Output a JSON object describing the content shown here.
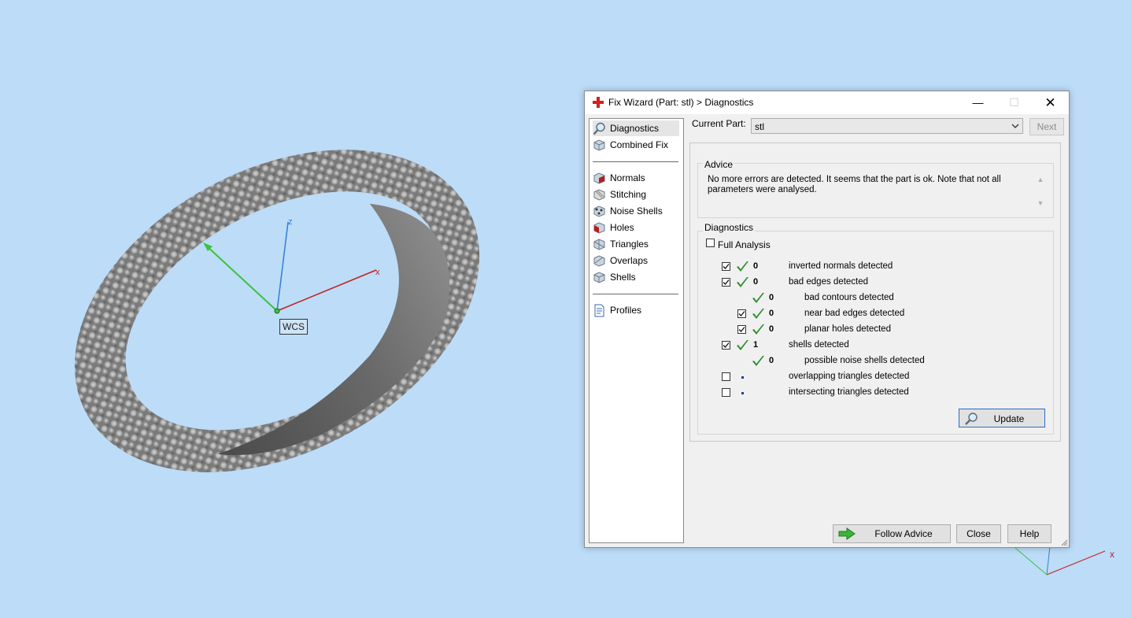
{
  "viewport": {
    "wcs_label": "WCS",
    "axis_z_label": "z",
    "axis_x_label": "x",
    "background_color": "#bcdcf8"
  },
  "dialog": {
    "title": "Fix Wizard (Part: stl) > Diagnostics",
    "window_controls": {
      "minimize": "—",
      "maximize": "☐",
      "close": "✕"
    },
    "nav": {
      "group1": [
        {
          "label": "Diagnostics",
          "icon": "magnifier-icon",
          "selected": true
        },
        {
          "label": "Combined Fix",
          "icon": "combined-fix-icon"
        }
      ],
      "group2": [
        {
          "label": "Normals",
          "icon": "normals-icon"
        },
        {
          "label": "Stitching",
          "icon": "stitching-icon"
        },
        {
          "label": "Noise Shells",
          "icon": "noise-shells-icon"
        },
        {
          "label": "Holes",
          "icon": "holes-icon"
        },
        {
          "label": "Triangles",
          "icon": "triangles-icon"
        },
        {
          "label": "Overlaps",
          "icon": "overlaps-icon"
        },
        {
          "label": "Shells",
          "icon": "shells-icon"
        }
      ],
      "group3": [
        {
          "label": "Profiles",
          "icon": "profiles-icon"
        }
      ]
    },
    "current_part": {
      "label": "Current Part:",
      "value": "stl",
      "next_label": "Next"
    },
    "advice": {
      "title": "Advice",
      "text": "No more errors are detected. It seems that the part is ok. Note that not all parameters were analysed."
    },
    "diagnostics": {
      "title": "Diagnostics",
      "full_analysis_label": "Full Analysis",
      "full_analysis_checked": false,
      "rows": [
        {
          "indent": 0,
          "has_checkbox": true,
          "checked": true,
          "status": "ok",
          "count": "0",
          "label": "inverted normals detected"
        },
        {
          "indent": 0,
          "has_checkbox": true,
          "checked": true,
          "status": "ok",
          "count": "0",
          "label": "bad edges detected"
        },
        {
          "indent": 1,
          "has_checkbox": false,
          "checked": false,
          "status": "ok",
          "count": "0",
          "label": "bad contours detected"
        },
        {
          "indent": 1,
          "has_checkbox": true,
          "checked": true,
          "status": "ok",
          "count": "0",
          "label": "near bad edges detected"
        },
        {
          "indent": 1,
          "has_checkbox": true,
          "checked": true,
          "status": "ok",
          "count": "0",
          "label": "planar holes detected"
        },
        {
          "indent": 0,
          "has_checkbox": true,
          "checked": true,
          "status": "ok",
          "count": "1",
          "label": "shells detected"
        },
        {
          "indent": 1,
          "has_checkbox": false,
          "checked": false,
          "status": "ok",
          "count": "0",
          "label": "possible noise shells detected"
        },
        {
          "indent": 0,
          "has_checkbox": true,
          "checked": false,
          "status": "pending",
          "count": "",
          "label": "overlapping triangles detected"
        },
        {
          "indent": 0,
          "has_checkbox": true,
          "checked": false,
          "status": "pending",
          "count": "",
          "label": "intersecting triangles detected"
        }
      ],
      "update_label": "Update"
    },
    "buttons": {
      "follow_advice": "Follow Advice",
      "close": "Close",
      "help": "Help"
    }
  }
}
